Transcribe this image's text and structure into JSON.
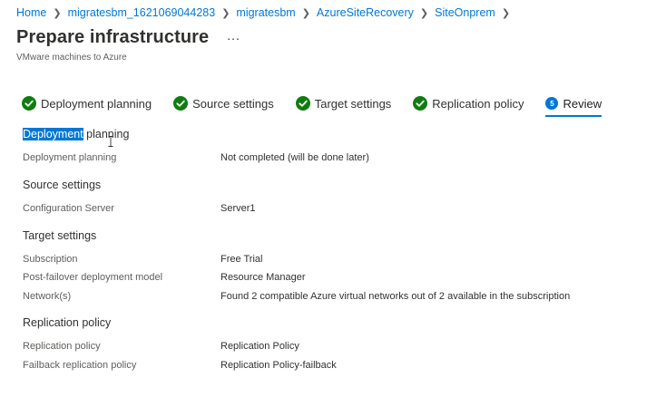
{
  "breadcrumb": {
    "items": [
      "Home",
      "migratesbm_1621069044283",
      "migratesbm",
      "AzureSiteRecovery",
      "SiteOnprem"
    ]
  },
  "header": {
    "title": "Prepare infrastructure",
    "more_label": "...",
    "subtitle": "VMware machines to Azure"
  },
  "tabs": [
    {
      "label": "Deployment planning",
      "status": "complete"
    },
    {
      "label": "Source settings",
      "status": "complete"
    },
    {
      "label": "Target settings",
      "status": "complete"
    },
    {
      "label": "Replication policy",
      "status": "complete"
    },
    {
      "label": "Review",
      "status": "current",
      "step": "5"
    }
  ],
  "review": {
    "deployment_planning": {
      "heading_selected": "Deployment",
      "heading_rest": " planning",
      "rows": [
        {
          "label": "Deployment planning",
          "value": "Not completed (will be done later)"
        }
      ]
    },
    "source_settings": {
      "heading": "Source settings",
      "rows": [
        {
          "label": "Configuration Server",
          "value": "Server1"
        }
      ]
    },
    "target_settings": {
      "heading": "Target settings",
      "rows": [
        {
          "label": "Subscription",
          "value": "Free Trial"
        },
        {
          "label": "Post-failover deployment model",
          "value": "Resource Manager"
        },
        {
          "label": "Network(s)",
          "value": "Found 2 compatible Azure virtual networks out of 2 available in the subscription"
        }
      ]
    },
    "replication_policy": {
      "heading": "Replication policy",
      "rows": [
        {
          "label": "Replication policy",
          "value": "Replication Policy"
        },
        {
          "label": "Failback replication policy",
          "value": "Replication Policy-failback"
        }
      ]
    }
  },
  "colors": {
    "accent": "#0078d4",
    "success": "#107c10",
    "text": "#323130",
    "muted": "#605e5c"
  }
}
